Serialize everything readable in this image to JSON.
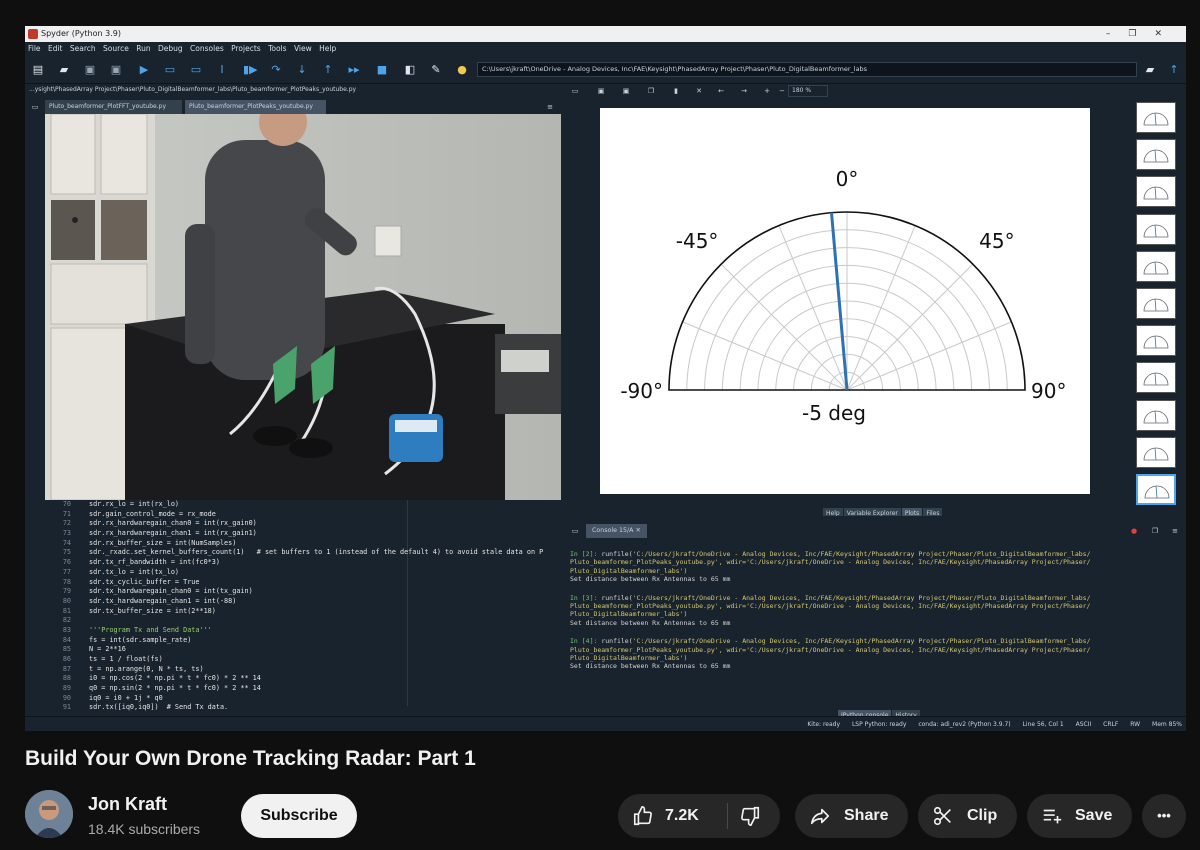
{
  "window": {
    "title": "Spyder (Python 3.9)",
    "menu": [
      "File",
      "Edit",
      "Search",
      "Source",
      "Run",
      "Debug",
      "Consoles",
      "Projects",
      "Tools",
      "View",
      "Help"
    ],
    "path": "C:\\Users\\jkraft\\OneDrive - Analog Devices, Inc\\FAE\\Keysight\\PhasedArray Project\\Phaser\\Pluto_DigitalBeamformer_labs",
    "path_strip": "...ysight\\PhasedArray Project\\Phaser\\Pluto_DigitalBeamformer_labs\\Pluto_beamformer_PlotPeaks_youtube.py"
  },
  "editor": {
    "tabs": [
      "Pluto_beamformer_PlotFFT_youtube.py",
      "Pluto_beamformer_PlotPeaks_youtube.py"
    ],
    "code": [
      {
        "n": "70",
        "t": "sdr.rx_lo = int(rx_lo)"
      },
      {
        "n": "71",
        "t": "sdr.gain_control_mode = rx_mode"
      },
      {
        "n": "72",
        "t": "sdr.rx_hardwaregain_chan0 = int(rx_gain0)"
      },
      {
        "n": "73",
        "t": "sdr.rx_hardwaregain_chan1 = int(rx_gain1)"
      },
      {
        "n": "74",
        "t": "sdr.rx_buffer_size = int(NumSamples)"
      },
      {
        "n": "75",
        "t": "sdr._rxadc.set_kernel_buffers_count(1)   # set buffers to 1 (instead of the default 4) to avoid stale data on P"
      },
      {
        "n": "76",
        "t": "sdr.tx_rf_bandwidth = int(fc0*3)"
      },
      {
        "n": "77",
        "t": "sdr.tx_lo = int(tx_lo)"
      },
      {
        "n": "78",
        "t": "sdr.tx_cyclic_buffer = True"
      },
      {
        "n": "79",
        "t": "sdr.tx_hardwaregain_chan0 = int(tx_gain)"
      },
      {
        "n": "80",
        "t": "sdr.tx_hardwaregain_chan1 = int(-88)"
      },
      {
        "n": "81",
        "t": "sdr.tx_buffer_size = int(2**18)"
      },
      {
        "n": "82",
        "t": ""
      },
      {
        "n": "83",
        "t": "'''Program Tx and Send Data'''"
      },
      {
        "n": "84",
        "t": "fs = int(sdr.sample_rate)"
      },
      {
        "n": "85",
        "t": "N = 2**16"
      },
      {
        "n": "86",
        "t": "ts = 1 / float(fs)"
      },
      {
        "n": "87",
        "t": "t = np.arange(0, N * ts, ts)"
      },
      {
        "n": "88",
        "t": "i0 = np.cos(2 * np.pi * t * fc0) * 2 ** 14"
      },
      {
        "n": "89",
        "t": "q0 = np.sin(2 * np.pi * t * fc0) * 2 ** 14"
      },
      {
        "n": "90",
        "t": "iq0 = i0 + 1j * q0"
      },
      {
        "n": "91",
        "t": "sdr.tx([iq0,iq0])  # Send Tx data."
      }
    ]
  },
  "plots": {
    "zoom": "180 %",
    "tabs": [
      "Help",
      "Variable Explorer",
      "Plots",
      "Files"
    ],
    "active_tab": "Plots"
  },
  "chart_data": {
    "type": "polar",
    "theta_range": [
      -90,
      90
    ],
    "angle_labels": [
      "-90°",
      "-45°",
      "0°",
      "45°",
      "90°"
    ],
    "steered_angle_deg": -5,
    "caption": "-5 deg",
    "line_color": "#2f72b4"
  },
  "console": {
    "tab": "Console 15/A",
    "blocks": [
      {
        "prompt": "In [2]:",
        "call": "runfile(",
        "arg": "'C:/Users/jkraft/OneDrive - Analog Devices, Inc/FAE/Keysight/PhasedArray Project/Phaser/Pluto_DigitalBeamformer_labs/",
        "arg2": "Pluto_beamformer_PlotPeaks_youtube.py', wdir='C:/Users/jkraft/OneDrive - Analog Devices, Inc/FAE/Keysight/PhasedArray Project/Phaser/",
        "arg3": "Pluto_DigitalBeamformer_labs')",
        "out": "Set distance between Rx Antennas to  65 mm"
      },
      {
        "prompt": "In [3]:",
        "call": "runfile(",
        "arg": "'C:/Users/jkraft/OneDrive - Analog Devices, Inc/FAE/Keysight/PhasedArray Project/Phaser/Pluto_DigitalBeamformer_labs/",
        "arg2": "Pluto_beamformer_PlotPeaks_youtube.py', wdir='C:/Users/jkraft/OneDrive - Analog Devices, Inc/FAE/Keysight/PhasedArray Project/Phaser/",
        "arg3": "Pluto_DigitalBeamformer_labs')",
        "out": "Set distance between Rx Antennas to  65 mm"
      },
      {
        "prompt": "In [4]:",
        "call": "runfile(",
        "arg": "'C:/Users/jkraft/OneDrive - Analog Devices, Inc/FAE/Keysight/PhasedArray Project/Phaser/Pluto_DigitalBeamformer_labs/",
        "arg2": "Pluto_beamformer_PlotPeaks_youtube.py', wdir='C:/Users/jkraft/OneDrive - Analog Devices, Inc/FAE/Keysight/PhasedArray Project/Phaser/",
        "arg3": "Pluto_DigitalBeamformer_labs')",
        "out": "Set distance between Rx Antennas to  65 mm"
      }
    ],
    "bottom_tabs": [
      "IPython console",
      "History"
    ]
  },
  "statusbar": [
    "Kite: ready",
    "LSP Python: ready",
    "conda: adi_rev2 (Python 3.9.7)",
    "Line 56, Col 1",
    "ASCII",
    "CRLF",
    "RW",
    "Mem 85%"
  ],
  "youtube": {
    "title": "Build Your Own Drone Tracking Radar: Part 1",
    "channel": "Jon Kraft",
    "subscribers": "18.4K subscribers",
    "subscribe_label": "Subscribe",
    "likes": "7.2K",
    "share_label": "Share",
    "clip_label": "Clip",
    "save_label": "Save",
    "more_label": "•••"
  }
}
